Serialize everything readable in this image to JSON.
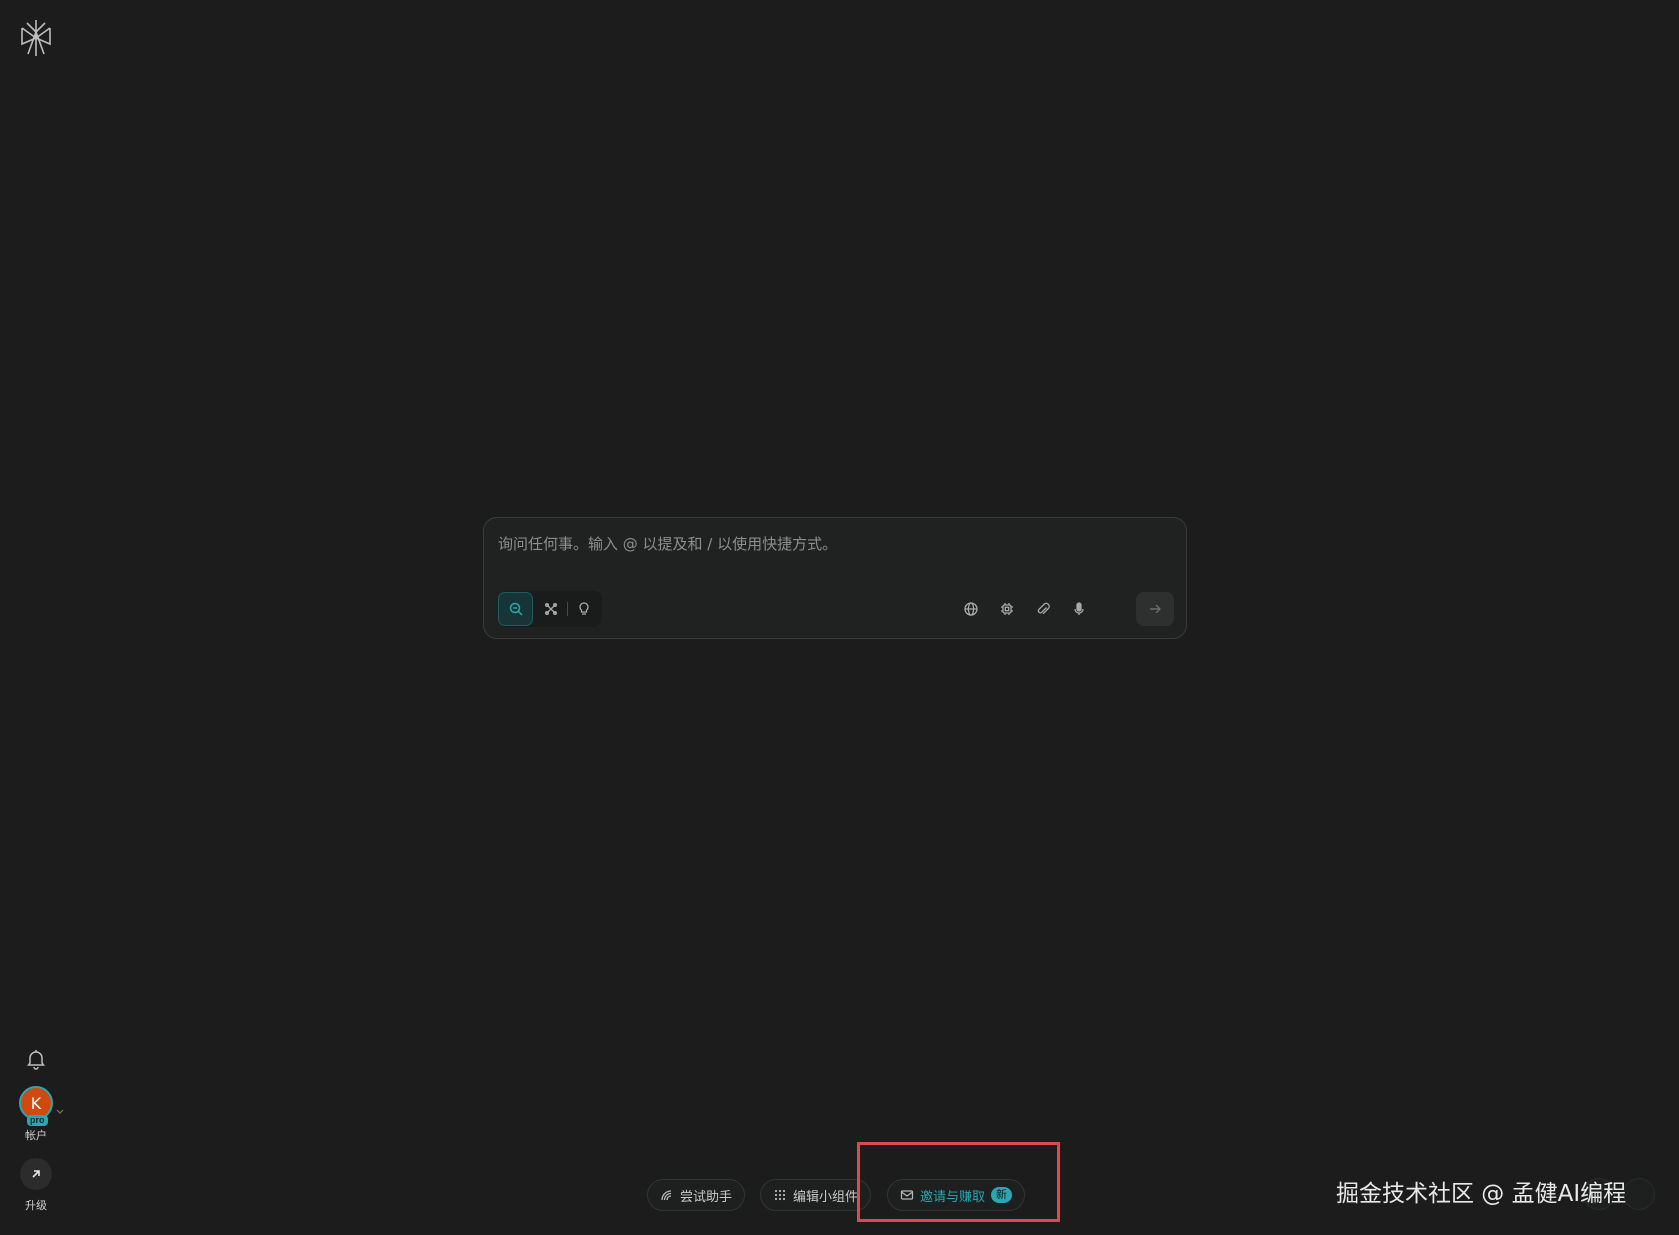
{
  "composer": {
    "placeholder": "询问任何事。输入 @ 以提及和 / 以使用快捷方式。",
    "modes": [
      "search-mode",
      "research-mode",
      "reasoning-mode"
    ],
    "tools": [
      "globe-icon",
      "cpu-icon",
      "paperclip-icon",
      "microphone-icon"
    ],
    "send_icon": "arrow-right-icon"
  },
  "rail": {
    "avatar_initial": "K",
    "pro_badge": "pro",
    "account_label": "帐户",
    "upgrade_label": "升级"
  },
  "chips": {
    "assistant": "尝试助手",
    "widgets": "编辑小组件",
    "invite": "邀请与赚取",
    "invite_badge": "新"
  },
  "watermark": "掘金技术社区 @ 孟健AI编程",
  "colors": {
    "background": "#1c1c1c",
    "accent": "#2aa7b2",
    "highlight": "#e0494b",
    "avatar": "#d04a10"
  }
}
